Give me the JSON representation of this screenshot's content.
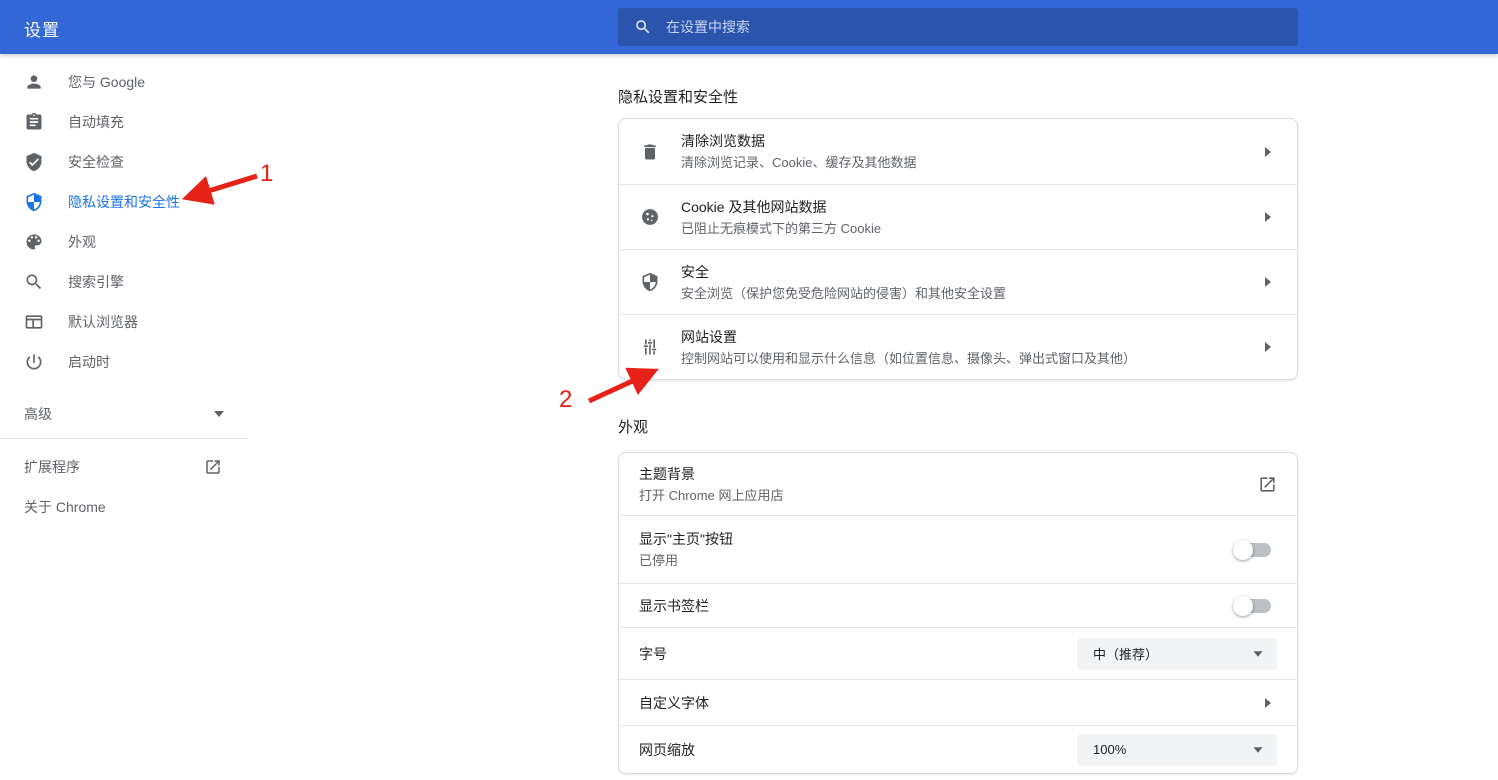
{
  "header": {
    "title": "设置",
    "search_placeholder": "在设置中搜索"
  },
  "colors": {
    "header_blue": "#3367d6",
    "accent_blue": "#1a73e8",
    "arrow_red": "#e62117"
  },
  "sidebar": {
    "items": [
      {
        "label": "您与 Google",
        "icon": "person-icon",
        "selected": false
      },
      {
        "label": "自动填充",
        "icon": "autofill-icon",
        "selected": false
      },
      {
        "label": "安全检查",
        "icon": "safety-check-icon",
        "selected": false
      },
      {
        "label": "隐私设置和安全性",
        "icon": "privacy-shield-icon",
        "selected": true
      },
      {
        "label": "外观",
        "icon": "palette-icon",
        "selected": false
      },
      {
        "label": "搜索引擎",
        "icon": "search-engine-icon",
        "selected": false
      },
      {
        "label": "默认浏览器",
        "icon": "browser-icon",
        "selected": false
      },
      {
        "label": "启动时",
        "icon": "power-icon",
        "selected": false
      }
    ],
    "advanced_label": "高级",
    "extensions_label": "扩展程序",
    "about_label": "关于 Chrome"
  },
  "privacy": {
    "title": "隐私设置和安全性",
    "rows": [
      {
        "icon": "trash-icon",
        "title": "清除浏览数据",
        "subtitle": "清除浏览记录、Cookie、缓存及其他数据"
      },
      {
        "icon": "cookie-icon",
        "title": "Cookie 及其他网站数据",
        "subtitle": "已阻止无痕模式下的第三方 Cookie"
      },
      {
        "icon": "shield-icon",
        "title": "安全",
        "subtitle": "安全浏览（保护您免受危险网站的侵害）和其他安全设置"
      },
      {
        "icon": "tune-icon",
        "title": "网站设置",
        "subtitle": "控制网站可以使用和显示什么信息（如位置信息、摄像头、弹出式窗口及其他）"
      }
    ]
  },
  "appearance": {
    "title": "外观",
    "rows": [
      {
        "title": "主题背景",
        "subtitle": "打开 Chrome 网上应用店",
        "control": "external-link"
      },
      {
        "title": "显示\"主页\"按钮",
        "subtitle": "已停用",
        "control": "toggle-off"
      },
      {
        "title": "显示书签栏",
        "control": "toggle-off"
      },
      {
        "title": "字号",
        "control": "select",
        "value": "中（推荐）"
      },
      {
        "title": "自定义字体",
        "control": "chevron"
      },
      {
        "title": "网页缩放",
        "control": "select",
        "value": "100%"
      }
    ]
  },
  "annotations": {
    "step1": "1",
    "step2": "2"
  }
}
